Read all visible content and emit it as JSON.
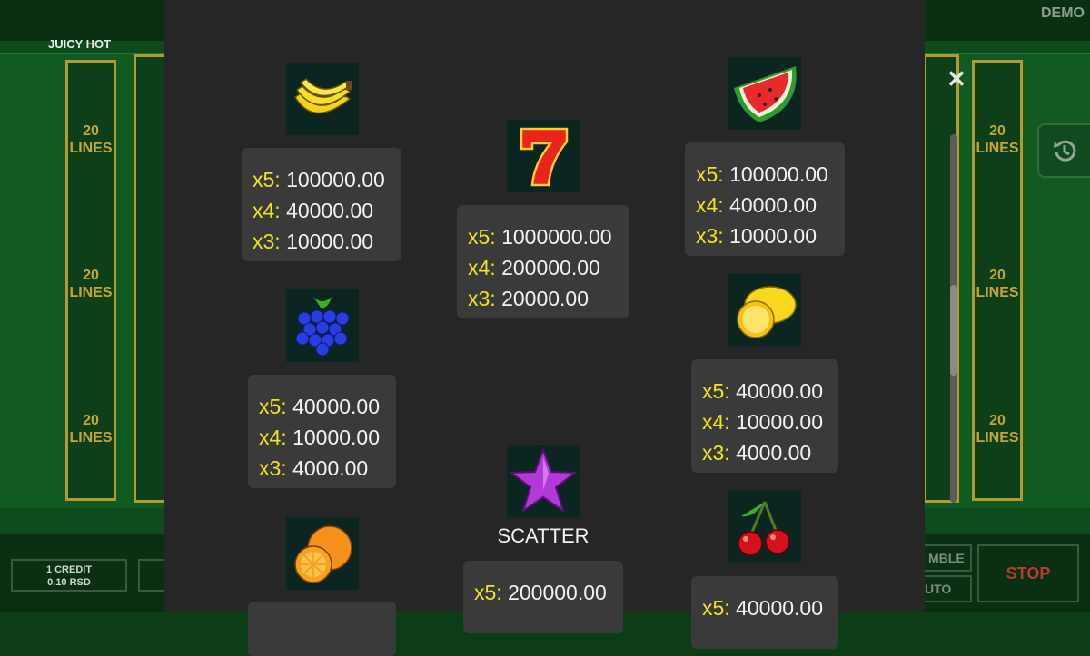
{
  "game": {
    "title": "JUICY HOT",
    "mode": "DEMO"
  },
  "reels": {
    "lines_number": "20",
    "lines_word": "LINES"
  },
  "footer": {
    "credit_line1": "1 CREDIT",
    "credit_line2": "0.10 RSD",
    "gamble_label": "MBLE",
    "auto_label": "UTO",
    "stop_label": "STOP"
  },
  "paytable": {
    "close_icon": "close-icon",
    "symbols": [
      {
        "id": "banana",
        "icon": "banana-icon",
        "payouts": [
          {
            "mult": "x5:",
            "value": "100000.00"
          },
          {
            "mult": "x4:",
            "value": "40000.00"
          },
          {
            "mult": "x3:",
            "value": "10000.00"
          }
        ]
      },
      {
        "id": "seven",
        "icon": "seven-icon",
        "payouts": [
          {
            "mult": "x5:",
            "value": "1000000.00"
          },
          {
            "mult": "x4:",
            "value": "200000.00"
          },
          {
            "mult": "x3:",
            "value": "20000.00"
          }
        ]
      },
      {
        "id": "watermelon",
        "icon": "watermelon-icon",
        "payouts": [
          {
            "mult": "x5:",
            "value": "100000.00"
          },
          {
            "mult": "x4:",
            "value": "40000.00"
          },
          {
            "mult": "x3:",
            "value": "10000.00"
          }
        ]
      },
      {
        "id": "grapes",
        "icon": "grapes-icon",
        "payouts": [
          {
            "mult": "x5:",
            "value": "40000.00"
          },
          {
            "mult": "x4:",
            "value": "10000.00"
          },
          {
            "mult": "x3:",
            "value": "4000.00"
          }
        ]
      },
      {
        "id": "lemon",
        "icon": "lemon-icon",
        "payouts": [
          {
            "mult": "x5:",
            "value": "40000.00"
          },
          {
            "mult": "x4:",
            "value": "10000.00"
          },
          {
            "mult": "x3:",
            "value": "4000.00"
          }
        ]
      },
      {
        "id": "star",
        "icon": "star-icon",
        "label": "SCATTER",
        "payouts": [
          {
            "mult": "x5:",
            "value": "200000.00"
          }
        ]
      },
      {
        "id": "orange",
        "icon": "orange-icon",
        "payouts": []
      },
      {
        "id": "cherry",
        "icon": "cherry-icon",
        "payouts": [
          {
            "mult": "x5:",
            "value": "40000.00"
          }
        ]
      }
    ]
  },
  "colors": {
    "multiplier": "#f0e41a",
    "panel": "#262626",
    "payout_box": "#3a3a3a",
    "stop": "#b83a32"
  }
}
